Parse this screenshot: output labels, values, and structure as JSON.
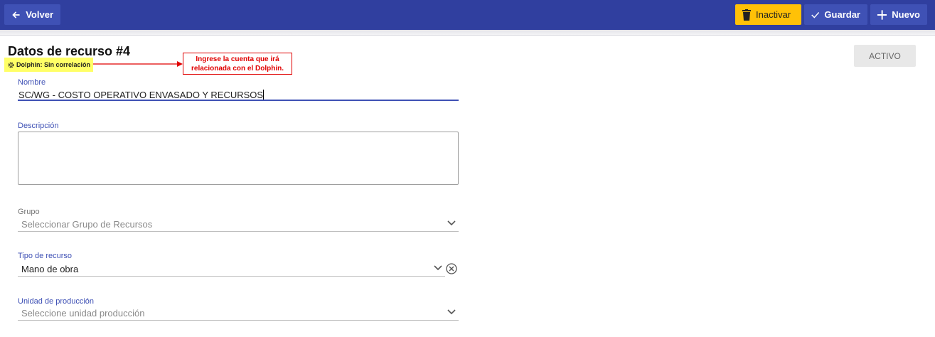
{
  "toolbar": {
    "back_label": "Volver",
    "inactivar_label": "Inactivar",
    "guardar_label": "Guardar",
    "nuevo_label": "Nuevo"
  },
  "header": {
    "title": "Datos de recurso #4",
    "dolphin_badge": "Dolphin: Sin correlación",
    "callout_line1": "Ingrese la cuenta que irá",
    "callout_line2": "relacionada con el Dolphin.",
    "status": "ACTIVO"
  },
  "form": {
    "nombre": {
      "label": "Nombre",
      "value": "SC/WG - COSTO OPERATIVO ENVASADO Y RECURSOS"
    },
    "descripcion": {
      "label": "Descripción",
      "value": ""
    },
    "grupo": {
      "label": "Grupo",
      "placeholder": "Seleccionar Grupo de Recursos"
    },
    "tipo": {
      "label": "Tipo de recurso",
      "value": "Mano de obra"
    },
    "unidad": {
      "label": "Unidad de producción",
      "placeholder": "Seleccione unidad producción"
    }
  },
  "colors": {
    "primary": "#303f9f",
    "button": "#3f51b5",
    "warning": "#ffc107",
    "highlight": "#ffff66",
    "callout": "#e00000"
  },
  "icons": [
    "arrow-left-icon",
    "trash-icon",
    "check-icon",
    "plus-icon",
    "gear-icon",
    "chevron-down-icon",
    "clear-icon"
  ]
}
